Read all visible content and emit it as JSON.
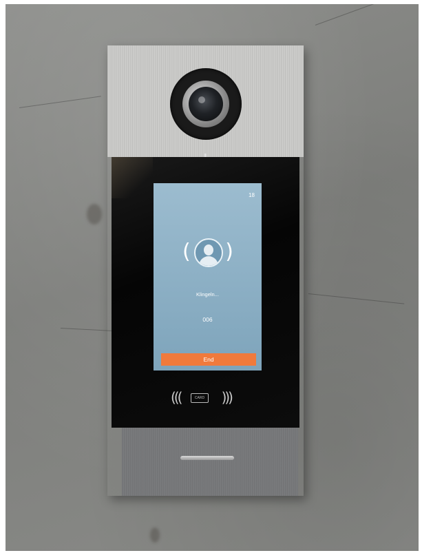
{
  "intercom": {
    "screen": {
      "time": "18",
      "status_text": "Klingeln...",
      "room_number": "006",
      "end_button_label": "End"
    },
    "card_reader_label": "CARD"
  },
  "colors": {
    "screen_background": "#8fb3c8",
    "end_button": "#f07a3c",
    "panel_glass": "#0b0b0b",
    "wall": "#858683"
  },
  "icons": [
    "camera-icon",
    "avatar-icon",
    "nfc-card-icon"
  ]
}
